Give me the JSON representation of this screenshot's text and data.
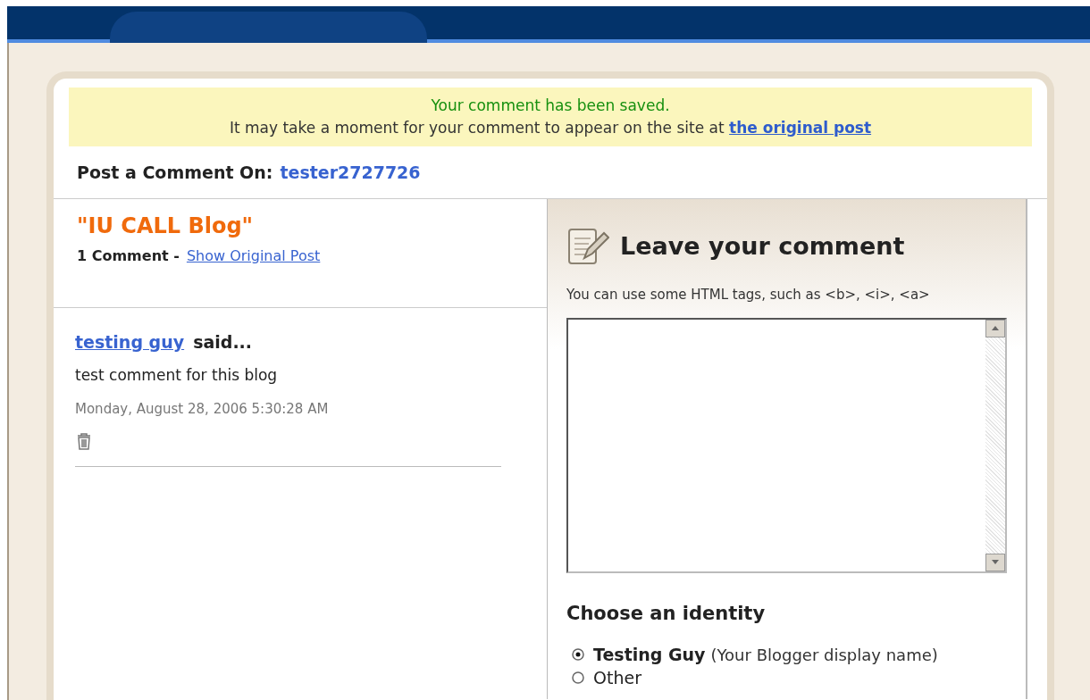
{
  "notice": {
    "title": "Your comment has been saved.",
    "message": "It may take a moment for your comment to appear on the site at",
    "link": "the original post"
  },
  "header": {
    "label": "Post a Comment On:",
    "blog": "tester2727726"
  },
  "post": {
    "title": "\"IU CALL Blog\"",
    "count": "1 Comment -",
    "link": "Show Original Post"
  },
  "comments": [
    {
      "author": "testing guy",
      "said": "said...",
      "body": "test comment for this blog",
      "date": "Monday, August 28, 2006 5:30:28 AM"
    }
  ],
  "form": {
    "title": "Leave your comment",
    "hint": "You can use some HTML tags, such as <b>, <i>, <a>",
    "identity_title": "Choose an identity",
    "identities": [
      {
        "label": "Testing Guy",
        "note": "(Your Blogger display name)",
        "selected": true
      },
      {
        "label": "Other",
        "selected": false
      }
    ]
  }
}
